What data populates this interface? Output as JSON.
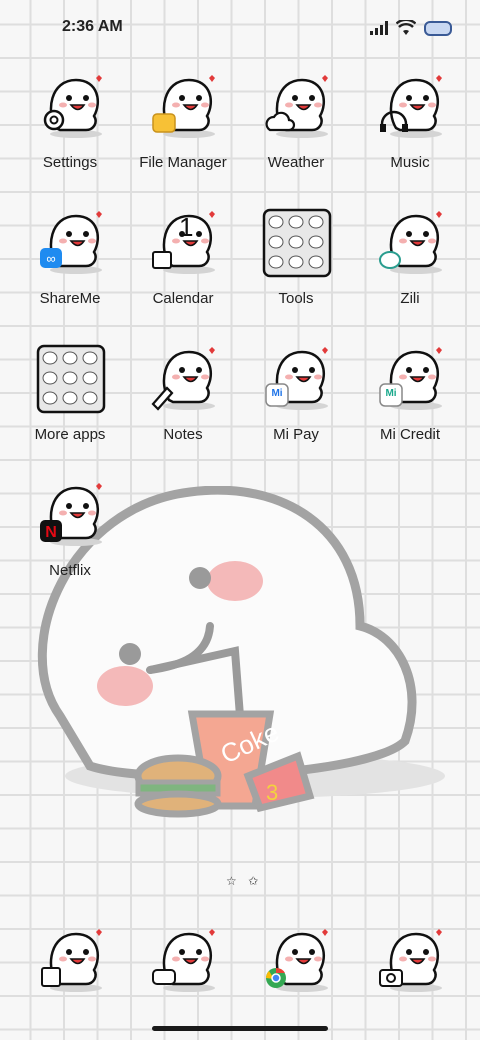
{
  "status_bar": {
    "time": "2:36 AM",
    "icons": [
      "signal-icon",
      "wifi-icon",
      "battery-icon"
    ]
  },
  "apps": [
    {
      "label": "Settings",
      "badge": "gear"
    },
    {
      "label": "File Manager",
      "badge": "folder"
    },
    {
      "label": "Weather",
      "badge": "cloud"
    },
    {
      "label": "Music",
      "badge": "headphones"
    },
    {
      "label": "ShareMe",
      "badge": "infinity"
    },
    {
      "label": "Calendar",
      "badge": "1"
    },
    {
      "label": "Tools",
      "badge": "folder-grid"
    },
    {
      "label": "Zili",
      "badge": "zili"
    },
    {
      "label": "More apps",
      "badge": "folder-grid"
    },
    {
      "label": "Notes",
      "badge": "pen"
    },
    {
      "label": "Mi Pay",
      "badge": "Mi Pay"
    },
    {
      "label": "Mi Credit",
      "badge": "Mi Credit"
    },
    {
      "label": "Netflix",
      "badge": "N"
    }
  ],
  "dock": [
    {
      "name": "phone",
      "badge": "phone-icon"
    },
    {
      "name": "messages",
      "badge": "message-icon"
    },
    {
      "name": "chrome",
      "badge": "chrome-icon"
    },
    {
      "name": "camera",
      "badge": "camera-icon"
    }
  ],
  "wallpaper": {
    "cup_text": "Coke",
    "fries_number": "3"
  },
  "page_indicator": "☆ ✩",
  "colors": {
    "grid": "#dedede",
    "cheek": "#f4b0b0",
    "outline": "#111111"
  }
}
